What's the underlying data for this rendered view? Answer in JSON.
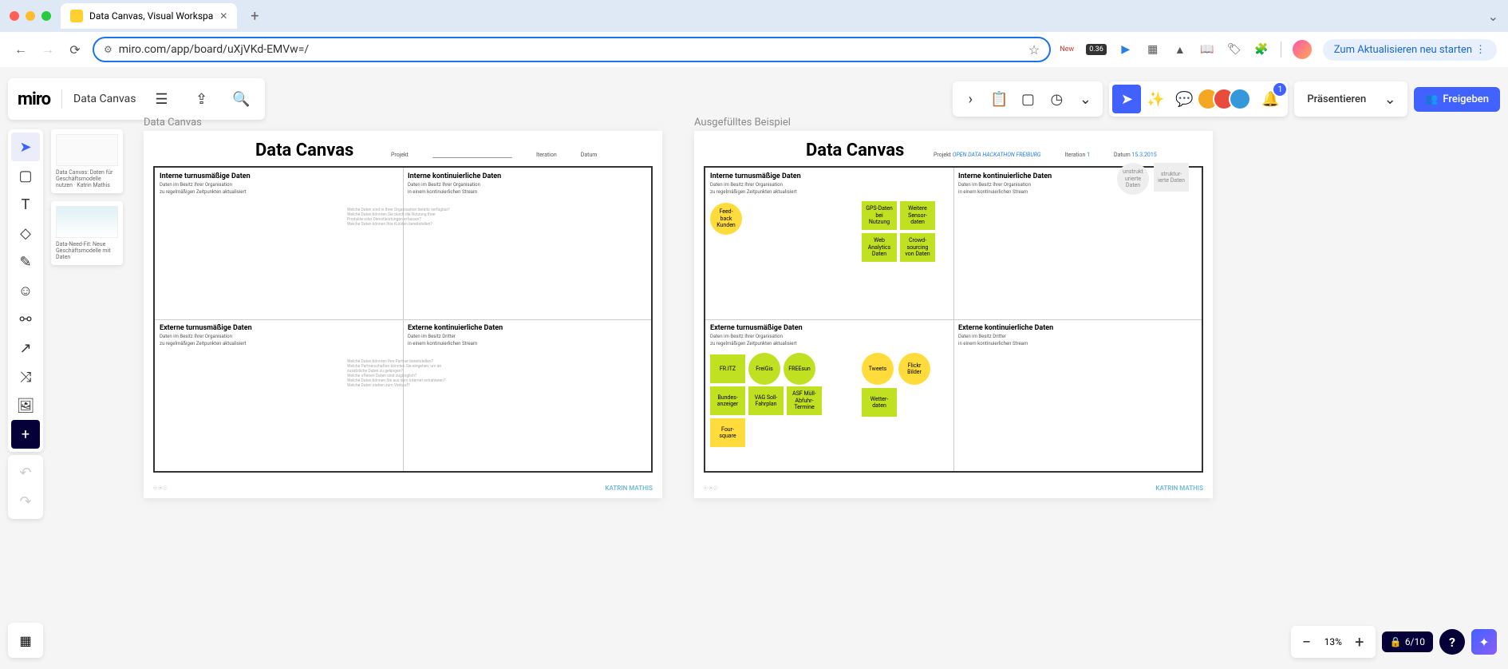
{
  "browser": {
    "tab_title": "Data Canvas, Visual Workspa",
    "url": "miro.com/app/board/uXjVKd-EMVw=/",
    "update_label": "Zum Aktualisieren neu starten",
    "ext_new": "New",
    "ext_score": "0.36"
  },
  "miro": {
    "logo": "miro",
    "board_title": "Data Canvas",
    "present": "Präsentieren",
    "share": "Freigeben",
    "notification_count": "1",
    "zoom": "13%",
    "counter": "6/10"
  },
  "frame_thumbs": [
    {
      "title": "Data Canvas: Daten für Geschäftsmodelle nutzen · Katrin Mathis"
    },
    {
      "title": "Data-Need-Fit: Neue Geschäftsmodelle mit Daten"
    }
  ],
  "left_canvas": {
    "label": "Data Canvas",
    "title": "Data Canvas",
    "meta": {
      "project": "Projekt",
      "iteration": "Iteration",
      "date": "Datum"
    },
    "quads": {
      "tl": {
        "title": "Interne turnusmäßige Daten",
        "sub1": "Daten im Besitz Ihrer Organisation",
        "sub2": "zu regelmäßigen Zeitpunkten aktualisiert"
      },
      "tr": {
        "title": "Interne kontinuierliche Daten",
        "sub1": "Daten im Besitz Ihrer Organisation",
        "sub2": "in einem kontinuierlichen Stream",
        "hint": "Welche Daten sind in Ihrer Organisation bereits verfügbar?\nWelche Daten könnten Sie durch die Nutzung Ihrer Produkte oder Dienstleistungen erfassen?\nWelche Daten können Ihre Kunden bereitstellen?"
      },
      "bl": {
        "title": "Externe turnusmäßige Daten",
        "sub1": "Daten im Besitz Ihrer Organisation",
        "sub2": "zu regelmäßigen Zeitpunkten aktualisiert"
      },
      "br": {
        "title": "Externe kontinuierliche Daten",
        "sub1": "Daten im Besitz Dritter",
        "sub2": "in einem kontinuierlichen Stream",
        "hint": "Welche Daten könnten Ihre Partner bereitstellen?\nWelche Partnerschaften könnten Sie eingehen, um an zusätzliche Daten zu gelangen?\nWelche offenen Daten sind zugänglich?\nWelche Daten können Sie aus dem Internet extrahieren?\nWelche Daten stehen zum Verkauf?"
      }
    },
    "footer_brand": "KATRIN MATHIS"
  },
  "right_canvas": {
    "label": "Ausgefülltes Beispiel",
    "title": "Data Canvas",
    "meta": {
      "project_label": "Projekt",
      "project_val": "OPEN DATA HACKATHON FREIBURG",
      "iteration_label": "Iteration",
      "iteration_val": "1",
      "date_label": "Datum",
      "date_val": "15.3.2015"
    },
    "quads": {
      "tl": {
        "title": "Interne turnusmäßige Daten",
        "sub1": "Daten im Besitz Ihrer Organisation",
        "sub2": "zu regelmäßigen Zeitpunkten aktualisiert"
      },
      "tr": {
        "title": "Interne kontinuierliche Daten",
        "sub1": "Daten im Besitz Ihrer Organisation",
        "sub2": "in einem kontinuierlichen Stream"
      },
      "bl": {
        "title": "Externe turnusmäßige Daten",
        "sub1": "Daten im Besitz Ihrer Organisation",
        "sub2": "zu regelmäßigen Zeitpunkten aktualisiert"
      },
      "br": {
        "title": "Externe kontinuierliche Daten",
        "sub1": "Daten im Besitz Dritter",
        "sub2": "in einem kontinuierlichen Stream"
      }
    },
    "stickies": {
      "feedback": "Feed-back Kunden",
      "gps": "GPS-Daten bei Nutzung",
      "sensor": "Weitere Sensor-daten",
      "web": "Web Analytics Daten",
      "crowd": "Crowd-sourcing von Daten",
      "unstruct": "unstrukt urierte Daten",
      "struct": "struktur-ierte Daten",
      "fritz": "FR.ITZ",
      "freigis": "FreiGis",
      "freesun": "FREEsun",
      "bundes": "Bundes-anzeiger",
      "vag": "VAG Soll-Fahrplan",
      "asf": "ASF Müll-Abfuhr-Termine",
      "foursq": "Four-square",
      "tweets": "Tweets",
      "flickr": "Flickr Bilder",
      "wetter": "Wetter-daten"
    },
    "footer_brand": "KATRIN MATHIS"
  }
}
